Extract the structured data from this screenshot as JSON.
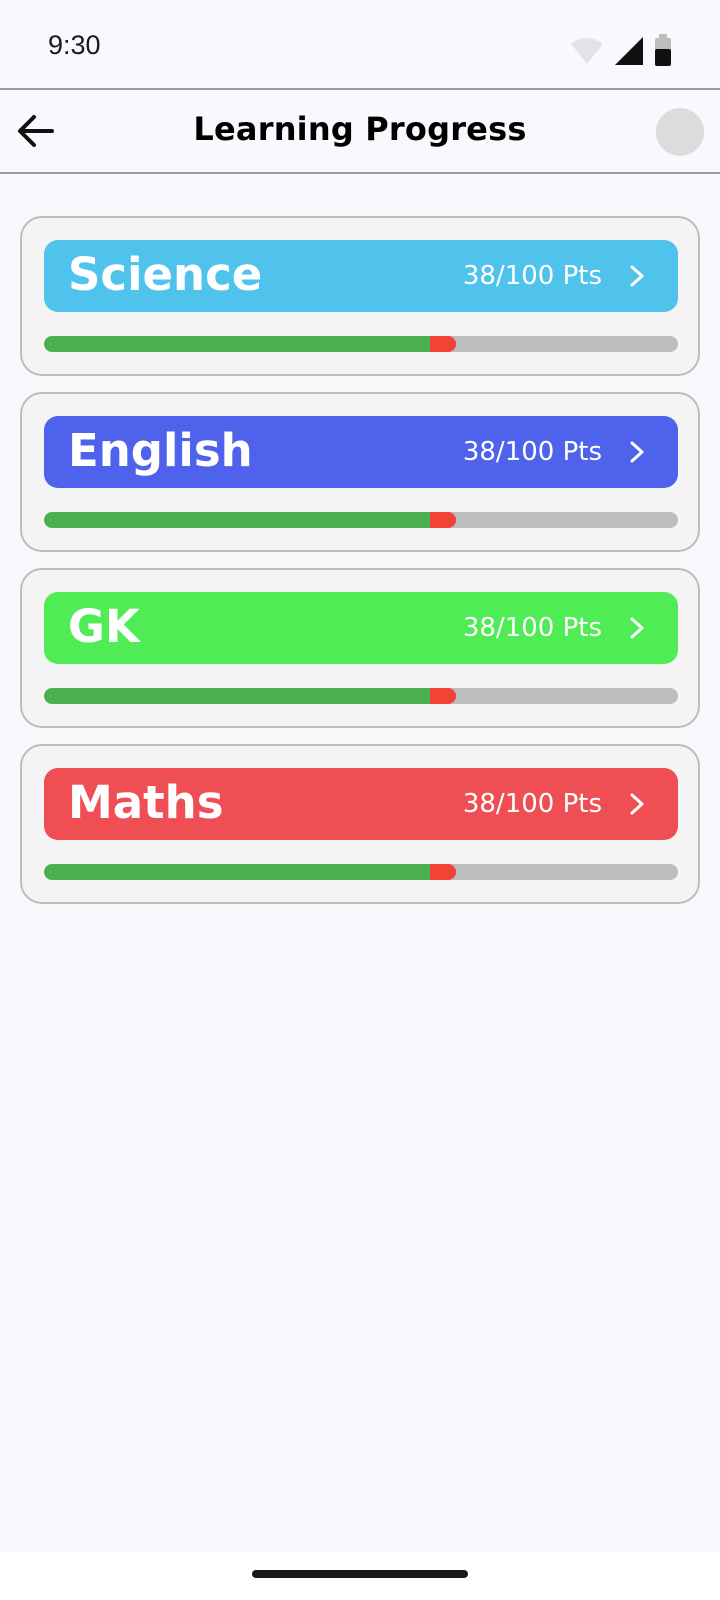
{
  "status_bar": {
    "time": "9:30"
  },
  "app_bar": {
    "title": "Learning Progress"
  },
  "subjects": [
    {
      "name": "Science",
      "points": "38/100 Pts",
      "progress": 0.65,
      "color": "#4fc3eb"
    },
    {
      "name": "English",
      "points": "38/100 Pts",
      "progress": 0.65,
      "color": "#4e62eb"
    },
    {
      "name": "GK",
      "points": "38/100 Pts",
      "progress": 0.65,
      "color": "#4fec56"
    },
    {
      "name": "Maths",
      "points": "38/100 Pts",
      "progress": 0.65,
      "color": "#ef4f54"
    }
  ],
  "colors": {
    "progress_done": "#4caf50",
    "progress_tip": "#f44336",
    "progress_track": "#bdbdbd"
  },
  "icons": [
    "back-arrow-icon",
    "wifi-icon",
    "signal-icon",
    "battery-icon",
    "chevron-right-icon"
  ]
}
